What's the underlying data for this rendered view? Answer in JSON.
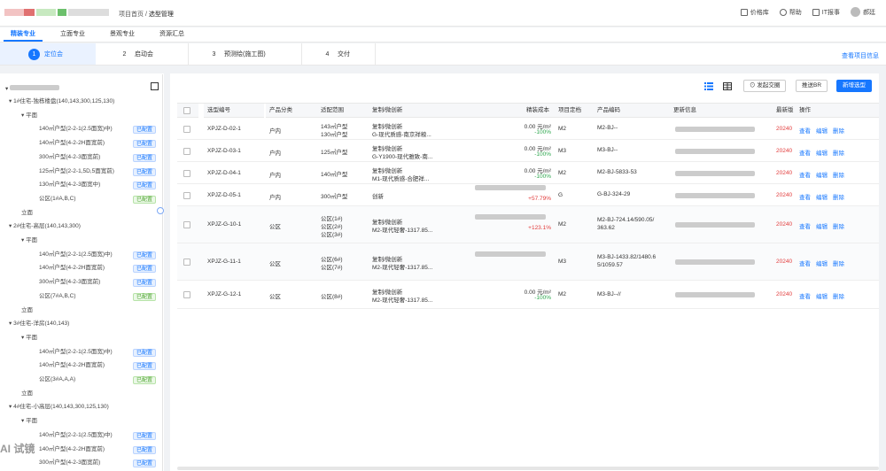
{
  "header": {
    "breadcrumb_root": "项目首页",
    "breadcrumb_sep": "/",
    "breadcrumb_current": "选型管理",
    "links": [
      "价格库",
      "帮助",
      "IT报事"
    ],
    "user": "郝廷"
  },
  "tabs": [
    "精装专业",
    "立面专业",
    "景观专业",
    "资源汇总"
  ],
  "steps": [
    {
      "n": "1",
      "label": "定位会"
    },
    {
      "n": "2",
      "label": "启动会"
    },
    {
      "n": "3",
      "label": "预测绘(施工图)"
    },
    {
      "n": "4",
      "label": "交付"
    }
  ],
  "view_project_info": "查看项目信息",
  "toolbar": {
    "initiate": "发起交圈",
    "push": "推送BR",
    "add": "新增选型"
  },
  "tree": [
    {
      "t": "1#住宅-独栋楼盘(140,143,300,125,130)",
      "lv": 1
    },
    {
      "t": "平面",
      "lv": 2
    },
    {
      "t": "140㎡户型(2-2-1(2.5面宽)中)",
      "lv": 3,
      "tag": "已配置",
      "c": "b"
    },
    {
      "t": "140㎡户型(4-2-2H面宽前)",
      "lv": 3,
      "tag": "已配置",
      "c": "b"
    },
    {
      "t": "300㎡户型(4-2-3面宽前)",
      "lv": 3,
      "tag": "已配置",
      "c": "b"
    },
    {
      "t": "125㎡户型(2-2-1,5D,5面宽前)",
      "lv": 3,
      "tag": "已配置",
      "c": "b"
    },
    {
      "t": "130㎡户型(4-2-3面宽中)",
      "lv": 3,
      "tag": "已配置",
      "c": "b"
    },
    {
      "t": "公区(1#A,B,C)",
      "lv": 3,
      "tag": "已配置",
      "c": "g"
    },
    {
      "t": "立面",
      "lv": 2
    },
    {
      "t": "2#住宅-高层(140,143,300)",
      "lv": 1
    },
    {
      "t": "平面",
      "lv": 2
    },
    {
      "t": "140㎡户型(2-2-1(2.5面宽)中)",
      "lv": 3,
      "tag": "已配置",
      "c": "b"
    },
    {
      "t": "140㎡户型(4-2-2H面宽前)",
      "lv": 3,
      "tag": "已配置",
      "c": "b"
    },
    {
      "t": "300㎡户型(4-2-3面宽前)",
      "lv": 3,
      "tag": "已配置",
      "c": "b"
    },
    {
      "t": "公区(7#A,B,C)",
      "lv": 3,
      "tag": "已配置",
      "c": "g"
    },
    {
      "t": "立面",
      "lv": 2
    },
    {
      "t": "3#住宅-洋房(140,143)",
      "lv": 1
    },
    {
      "t": "平面",
      "lv": 2
    },
    {
      "t": "140㎡户型(2-2-1(2.5面宽)中)",
      "lv": 3,
      "tag": "已配置",
      "c": "b"
    },
    {
      "t": "140㎡户型(4-2-2H面宽前)",
      "lv": 3,
      "tag": "已配置",
      "c": "b"
    },
    {
      "t": "公区(3#A,A,A)",
      "lv": 3,
      "tag": "已配置",
      "c": "g"
    },
    {
      "t": "立面",
      "lv": 2
    },
    {
      "t": "4#住宅-小高层(140,143,300,125,130)",
      "lv": 1
    },
    {
      "t": "平面",
      "lv": 2
    },
    {
      "t": "140㎡户型(2-2-1(2.5面宽)中)",
      "lv": 3,
      "tag": "已配置",
      "c": "b"
    },
    {
      "t": "140㎡户型(4-2-2H面宽前)",
      "lv": 3,
      "tag": "已配置",
      "c": "b"
    },
    {
      "t": "300㎡户型(4-2-3面宽前)",
      "lv": 3,
      "tag": "已配置",
      "c": "b"
    }
  ],
  "table": {
    "headers": [
      "选型编号",
      "产品分类",
      "适配范围",
      "复制/微创新",
      "精装成本",
      "项目定档",
      "产品编码",
      "更新信息",
      "最新版",
      "操作"
    ],
    "rows": [
      {
        "id": "XPJZ-D-02-1",
        "cat": "户内",
        "scope": [
          "143㎡户型",
          "130㎡户型"
        ],
        "copy": [
          "复制/微创新",
          "G-现代质感-南京祥粮..."
        ],
        "cost": [
          "0.00 元/m²",
          "-100%"
        ],
        "level": "M2",
        "code": [
          "M2-BJ--"
        ],
        "ver": "20240"
      },
      {
        "id": "XPJZ-D-03-1",
        "cat": "户内",
        "scope": [
          "125㎡户型"
        ],
        "copy": [
          "复制/微创新",
          "G-Y1900-现代雅致-南..."
        ],
        "cost": [
          "0.00 元/m²",
          "-100%"
        ],
        "level": "M3",
        "code": [
          "M3-BJ--"
        ],
        "ver": "20240"
      },
      {
        "id": "XPJZ-D-04-1",
        "cat": "户内",
        "scope": [
          "140㎡户型"
        ],
        "copy": [
          "复制/微创新",
          "M1-现代质感-合肥祥..."
        ],
        "cost": [
          "0.00 元/m²",
          "-100%"
        ],
        "level": "M2",
        "code": [
          "M2-BJ-5833-53"
        ],
        "ver": "20240"
      },
      {
        "id": "XPJZ-D-05-1",
        "cat": "户内",
        "scope": [
          "300㎡户型"
        ],
        "copy": [
          "创新"
        ],
        "cost": [
          "",
          "+57.79%"
        ],
        "level": "G",
        "code": [
          "G-BJ-324-29"
        ],
        "ver": "20240"
      },
      {
        "id": "XPJZ-G-10-1",
        "cat": "公区",
        "scope": [
          "公区(1#)",
          "公区(2#)",
          "公区(3#)"
        ],
        "copy": [
          "复制/微创新",
          "M2-现代轻奢-1317.85..."
        ],
        "cost": [
          "",
          "+123.1%"
        ],
        "level": "M2",
        "code": [
          "M2-BJ-724.14/590.05/",
          "363.62"
        ],
        "ver": "20240"
      },
      {
        "id": "XPJZ-G-11-1",
        "cat": "公区",
        "scope": [
          "公区(6#)",
          "公区(7#)"
        ],
        "copy": [
          "复制/微创新",
          "M2-现代轻奢-1317.85..."
        ],
        "cost": [
          "",
          ""
        ],
        "level": "M3",
        "code": [
          "M3-BJ-1433.82/1480.6",
          "5/1059.57"
        ],
        "ver": "20240"
      },
      {
        "id": "XPJZ-G-12-1",
        "cat": "公区",
        "scope": [
          "公区(8#)"
        ],
        "copy": [
          "复制/微创新",
          "M2-现代轻奢-1317.85..."
        ],
        "cost": [
          "0.00 元/m²",
          "-100%"
        ],
        "level": "M2",
        "code": [
          "M3-BJ--//"
        ],
        "ver": "20240"
      }
    ],
    "ops": [
      "查看",
      "编辑",
      "删除"
    ]
  },
  "watermark": "AI 试镜"
}
